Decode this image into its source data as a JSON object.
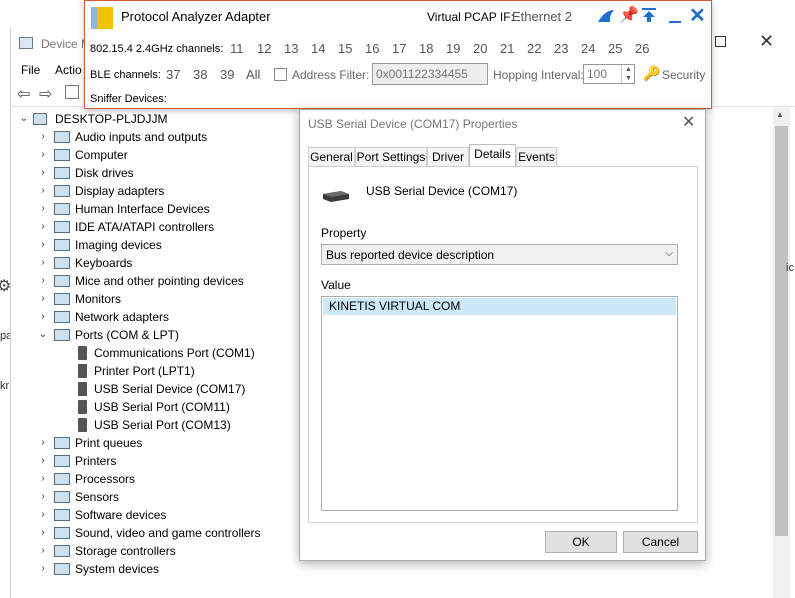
{
  "device_manager": {
    "title": "Device M",
    "menu": [
      "File",
      "Actio"
    ],
    "tree": {
      "root": "DESKTOP-PLJDJJM",
      "categories": [
        "Audio inputs and outputs",
        "Computer",
        "Disk drives",
        "Display adapters",
        "Human Interface Devices",
        "IDE ATA/ATAPI controllers",
        "Imaging devices",
        "Keyboards",
        "Mice and other pointing devices",
        "Monitors",
        "Network adapters",
        "Ports (COM & LPT)"
      ],
      "ports": [
        "Communications Port (COM1)",
        "Printer Port (LPT1)",
        "USB Serial Device (COM17)",
        "USB Serial Port (COM11)",
        "USB Serial Port (COM13)"
      ],
      "categories_after": [
        "Print queues",
        "Printers",
        "Processors",
        "Sensors",
        "Software devices",
        "Sound, video and game controllers",
        "Storage controllers",
        "System devices"
      ]
    }
  },
  "left_window": {
    "fragments": [
      "pa",
      "kr"
    ]
  },
  "right_fragment": "ic",
  "protocol_analyzer": {
    "title": "Protocol Analyzer Adapter",
    "virtual_pcap_label": "Virtual PCAP IF:",
    "virtual_pcap_value": "Ethernet 2",
    "channels_label": "802.15.4 2.4GHz channels:",
    "channels": [
      "11",
      "12",
      "13",
      "14",
      "15",
      "16",
      "17",
      "18",
      "19",
      "20",
      "21",
      "22",
      "23",
      "24",
      "25",
      "26"
    ],
    "ble_label": "BLE channels:",
    "ble_channels": [
      "37",
      "38",
      "39",
      "All"
    ],
    "address_filter_label": "Address Filter:",
    "address_filter_placeholder": "0x001122334455",
    "hopping_label": "Hopping Interval:",
    "hopping_value": "100",
    "security_label": "Security",
    "sniffer_label": "Sniffer Devices:",
    "colors": {
      "accent": "#1e6fd0",
      "border": "#d05a3a"
    }
  },
  "properties_dialog": {
    "title": "USB Serial Device (COM17) Properties",
    "tabs": [
      "General",
      "Port Settings",
      "Driver",
      "Details",
      "Events"
    ],
    "active_tab": "Details",
    "device_name": "USB Serial Device (COM17)",
    "property_label": "Property",
    "property_selected": "Bus reported device description",
    "value_label": "Value",
    "value_items": [
      "KINETIS VIRTUAL COM"
    ],
    "ok_label": "OK",
    "cancel_label": "Cancel"
  }
}
